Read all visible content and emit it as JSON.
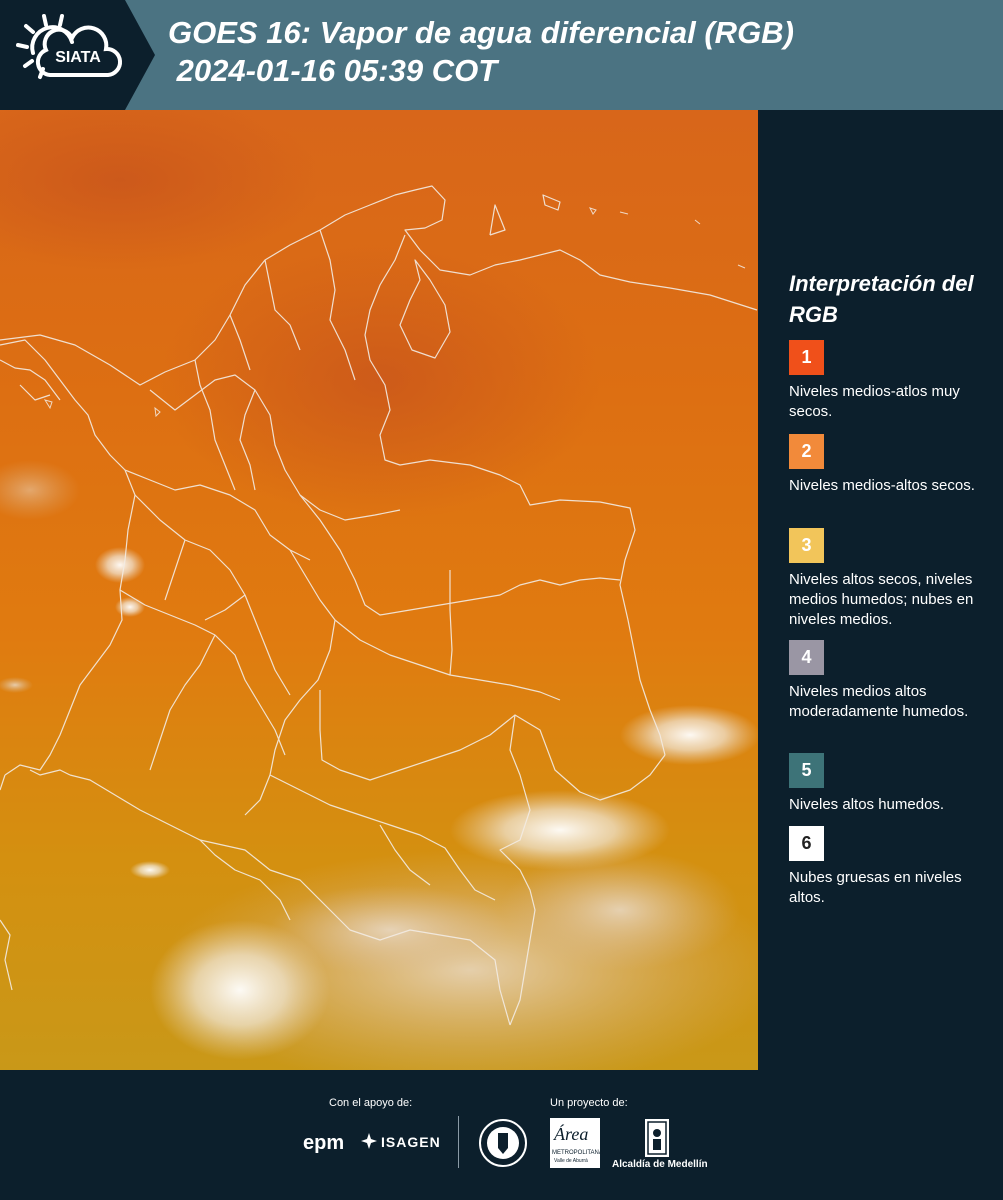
{
  "header": {
    "logo_text": "SIATA",
    "title": "GOES 16: Vapor de agua diferencial (RGB)\n 2024-01-16 05:39 COT"
  },
  "map": {
    "image_label": "Imagen satelital GOES 16 - Vapor de agua diferencial"
  },
  "legend": {
    "title": "Interpretación del RGB",
    "items": [
      {
        "num": "1",
        "color": "#f0501a",
        "text": "Niveles medios-atlos muy secos."
      },
      {
        "num": "2",
        "color": "#f28a3a",
        "text": "Niveles medios-altos secos."
      },
      {
        "num": "3",
        "color": "#f2c55a",
        "text": "Niveles altos secos, niveles medios humedos; nubes en niveles medios."
      },
      {
        "num": "4",
        "color": "#9a96a4",
        "text": "Niveles medios altos moderadamente humedos."
      },
      {
        "num": "5",
        "color": "#3d7378",
        "text": "Niveles altos humedos."
      },
      {
        "num": "6",
        "color": "#ffffff",
        "text": "Nubes gruesas en niveles altos."
      }
    ]
  },
  "footer": {
    "support_label": "Con el apoyo de:",
    "project_label": "Un proyecto de:",
    "logos": {
      "epm": "epm",
      "isagen": "ISAGEN",
      "area_metropolitana": "Área",
      "area_sub": "METROPOLITANA",
      "area_sub2": "Valle de Aburrá",
      "alcaldia": "Alcaldía de Medellín"
    }
  }
}
